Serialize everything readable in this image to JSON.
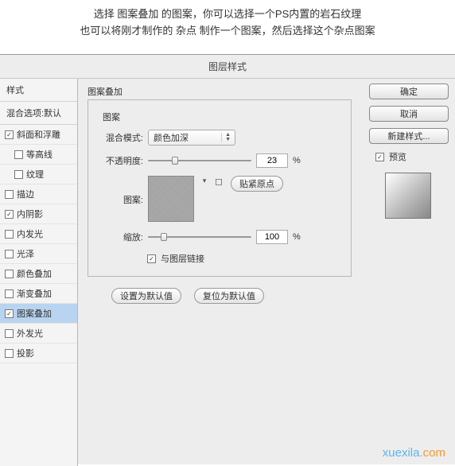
{
  "instruction": {
    "line1": "选择 图案叠加 的图案，你可以选择一个PS内置的岩石纹理",
    "line2": "也可以将刚才制作的 杂点 制作一个图案，然后选择这个杂点图案"
  },
  "dialog": {
    "title": "图层样式"
  },
  "sidebar": {
    "header": "样式",
    "blend_options": "混合选项:默认",
    "items": {
      "bevel_emboss": "斜面和浮雕",
      "contour": "等高线",
      "texture": "纹理",
      "stroke": "描边",
      "inner_shadow": "内阴影",
      "inner_glow": "内发光",
      "satin": "光泽",
      "color_overlay": "颜色叠加",
      "gradient_overlay": "渐变叠加",
      "pattern_overlay": "图案叠加",
      "outer_glow": "外发光",
      "drop_shadow": "投影"
    }
  },
  "panel": {
    "group_title": "图案叠加",
    "fieldset": "图案",
    "blend_mode_label": "混合模式:",
    "blend_mode_value": "颜色加深",
    "opacity_label": "不透明度:",
    "opacity_value": "23",
    "percent": "%",
    "pattern_label": "图案:",
    "snap_origin": "贴紧原点",
    "scale_label": "缩放:",
    "scale_value": "100",
    "link_layer": "与图层链接",
    "make_default": "设置为默认值",
    "reset_default": "复位为默认值"
  },
  "right": {
    "ok": "确定",
    "cancel": "取消",
    "new_style": "新建样式...",
    "preview": "预览"
  },
  "watermark": {
    "a": "xuexila",
    "b": ".com"
  }
}
